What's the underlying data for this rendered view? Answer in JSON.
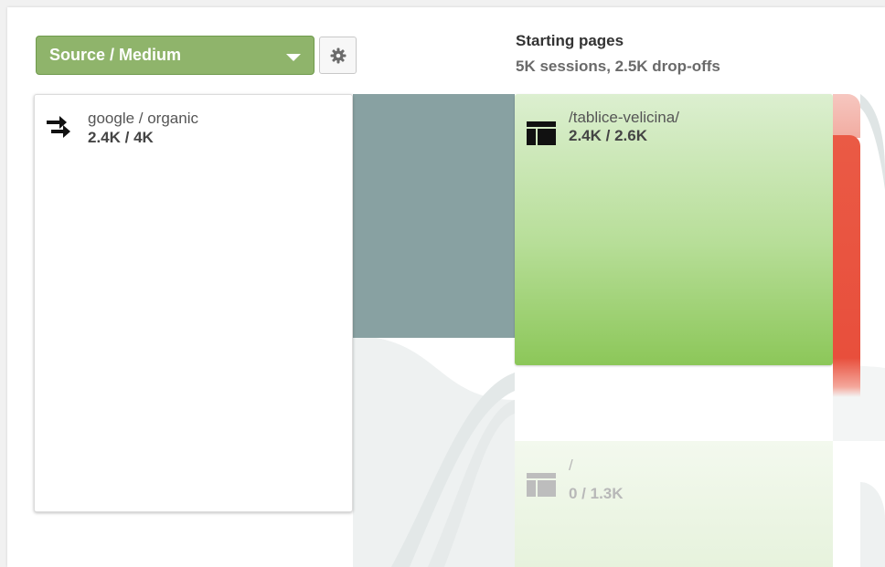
{
  "controls": {
    "dimension_label": "Source / Medium",
    "dimension_color": "#8fb46b",
    "settings_icon": "gear-icon"
  },
  "column": {
    "title": "Starting pages",
    "subtitle": "5K sessions, 2.5K drop-offs"
  },
  "source": {
    "name": "google / organic",
    "count": "2.4K / 4K",
    "icon": "traffic-source-arrows-icon"
  },
  "pages": [
    {
      "name": "/tablice-velicina/",
      "count": "2.4K / 2.6K",
      "icon": "page-layout-icon",
      "color": "#8cc759"
    },
    {
      "name": "/",
      "count": "0 / 1.3K",
      "icon": "page-layout-icon",
      "color": "#e6f2dc"
    }
  ],
  "colors": {
    "flow": "#88a1a2",
    "dropoff": "#e84f3c"
  }
}
